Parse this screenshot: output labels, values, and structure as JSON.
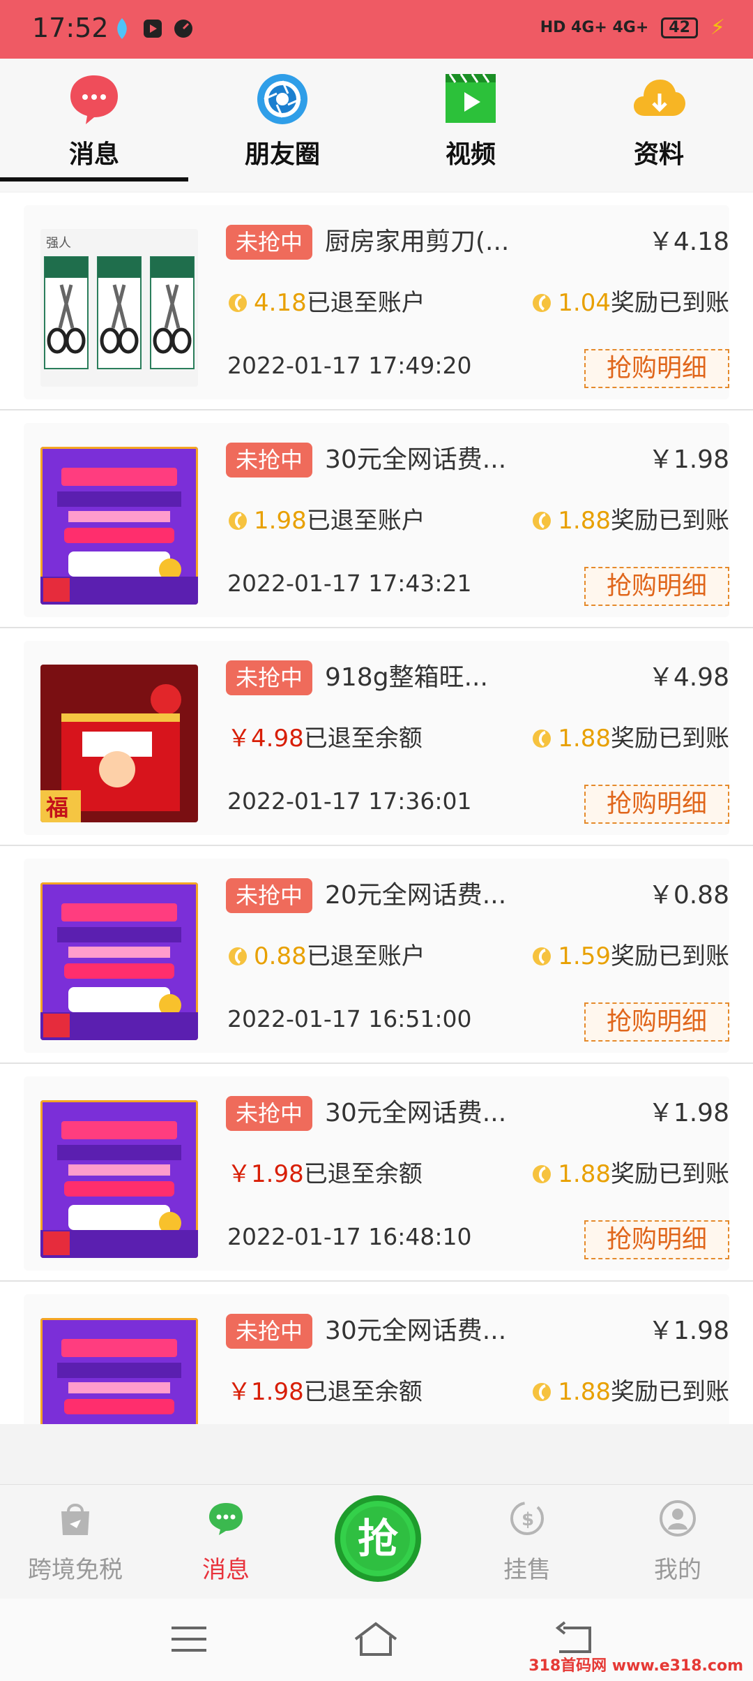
{
  "status": {
    "time": "17:52",
    "network": "HD 4G+ 4G+",
    "battery": "42"
  },
  "top_tabs": [
    {
      "label": "消息",
      "icon": "chat-bubble-icon",
      "active": true
    },
    {
      "label": "朋友圈",
      "icon": "camera-shutter-icon",
      "active": false
    },
    {
      "label": "视频",
      "icon": "video-play-icon",
      "active": false
    },
    {
      "label": "资料",
      "icon": "cloud-download-icon",
      "active": false
    }
  ],
  "items": [
    {
      "badge": "未抢中",
      "title": "厨房家用剪刀(...",
      "price": "￥4.18",
      "refund_amount": "4.18",
      "refund_text": "已退至账户",
      "refund_type": "coin",
      "reward_amount": "1.04",
      "reward_text": "奖励已到账",
      "datetime": "2022-01-17 17:49:20",
      "detail_label": "抢购明细",
      "thumb": "scissors",
      "thumb_text": "强人"
    },
    {
      "badge": "未抢中",
      "title": "30元全网话费...",
      "price": "￥1.98",
      "refund_amount": "1.98",
      "refund_text": "已退至账户",
      "refund_type": "coin",
      "reward_amount": "1.88",
      "reward_text": "奖励已到账",
      "datetime": "2022-01-17 17:43:21",
      "detail_label": "抢购明细",
      "thumb": "phone-credit",
      "thumb_text": "送福利抢话费"
    },
    {
      "badge": "未抢中",
      "title": "918g整箱旺...",
      "price": "￥4.98",
      "refund_amount": "￥4.98",
      "refund_text": "已退至余额",
      "refund_type": "money",
      "reward_amount": "1.88",
      "reward_text": "奖励已到账",
      "datetime": "2022-01-17 17:36:01",
      "detail_label": "抢购明细",
      "thumb": "gift-box",
      "thumb_text": "福"
    },
    {
      "badge": "未抢中",
      "title": "20元全网话费...",
      "price": "￥0.88",
      "refund_amount": "0.88",
      "refund_text": "已退至账户",
      "refund_type": "coin",
      "reward_amount": "1.59",
      "reward_text": "奖励已到账",
      "datetime": "2022-01-17 16:51:00",
      "detail_label": "抢购明细",
      "thumb": "phone-credit",
      "thumb_text": "送福利抢话费"
    },
    {
      "badge": "未抢中",
      "title": "30元全网话费...",
      "price": "￥1.98",
      "refund_amount": "￥1.98",
      "refund_text": "已退至余额",
      "refund_type": "money",
      "reward_amount": "1.88",
      "reward_text": "奖励已到账",
      "datetime": "2022-01-17 16:48:10",
      "detail_label": "抢购明细",
      "thumb": "phone-credit",
      "thumb_text": "送福利抢话费"
    },
    {
      "badge": "未抢中",
      "title": "30元全网话费...",
      "price": "￥1.98",
      "refund_amount": "￥1.98",
      "refund_text": "已退至余额",
      "refund_type": "money",
      "reward_amount": "1.88",
      "reward_text": "奖励已到账",
      "datetime": "",
      "detail_label": "",
      "thumb": "phone-credit",
      "thumb_text": "送福利抢话费"
    }
  ],
  "bottom_nav": [
    {
      "label": "跨境免税",
      "icon": "shopping-bag-icon",
      "active": false
    },
    {
      "label": "消息",
      "icon": "chat-icon",
      "active": true
    },
    {
      "label": "抢",
      "icon": "grab-button-icon",
      "active": false
    },
    {
      "label": "挂售",
      "icon": "sell-icon",
      "active": false
    },
    {
      "label": "我的",
      "icon": "profile-icon",
      "active": false
    }
  ],
  "watermark": "318首码网 www.e318.com",
  "colors": {
    "status_bar": "#ef5a64",
    "badge": "#ef6b5b",
    "accent_red": "#e8323c",
    "coin_amount": "#e8a000",
    "money_amount": "#d81e06",
    "detail_border": "#e58a2b",
    "grab_green": "#2ecc40"
  }
}
